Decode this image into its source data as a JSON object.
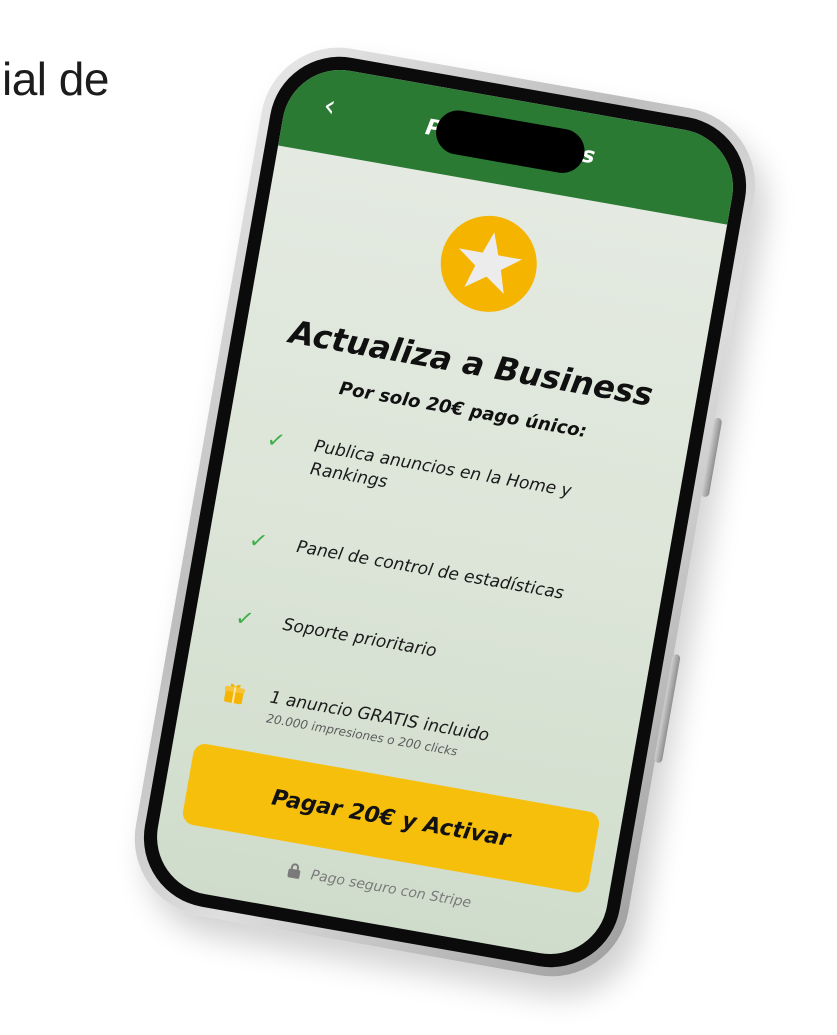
{
  "page": {
    "heading_fragment": "ial de"
  },
  "header": {
    "back_glyph": "‹",
    "title": "Plan Business"
  },
  "upgrade": {
    "title": "Actualiza a Business",
    "subtitle": "Por solo 20€ pago único:",
    "features": [
      {
        "label": "Publica anuncios en la Home y Rankings",
        "icon": "check-icon"
      },
      {
        "label": "Panel de control de estadísticas",
        "icon": "check-icon"
      },
      {
        "label": "Soporte prioritario",
        "icon": "check-icon"
      }
    ],
    "free_ad": {
      "icon": "gift-icon",
      "title": "1 anuncio GRATIS incluido",
      "subtitle": "20.000 impresiones o 200 clicks"
    },
    "pay_button": "Pagar 20€ y Activar",
    "secure_note": "Pago seguro con Stripe"
  },
  "colors": {
    "header_green": "#2a7a33",
    "accent_yellow": "#f6bf0c",
    "check_green": "#3fae4a",
    "badge_yellow": "#f4b400"
  }
}
